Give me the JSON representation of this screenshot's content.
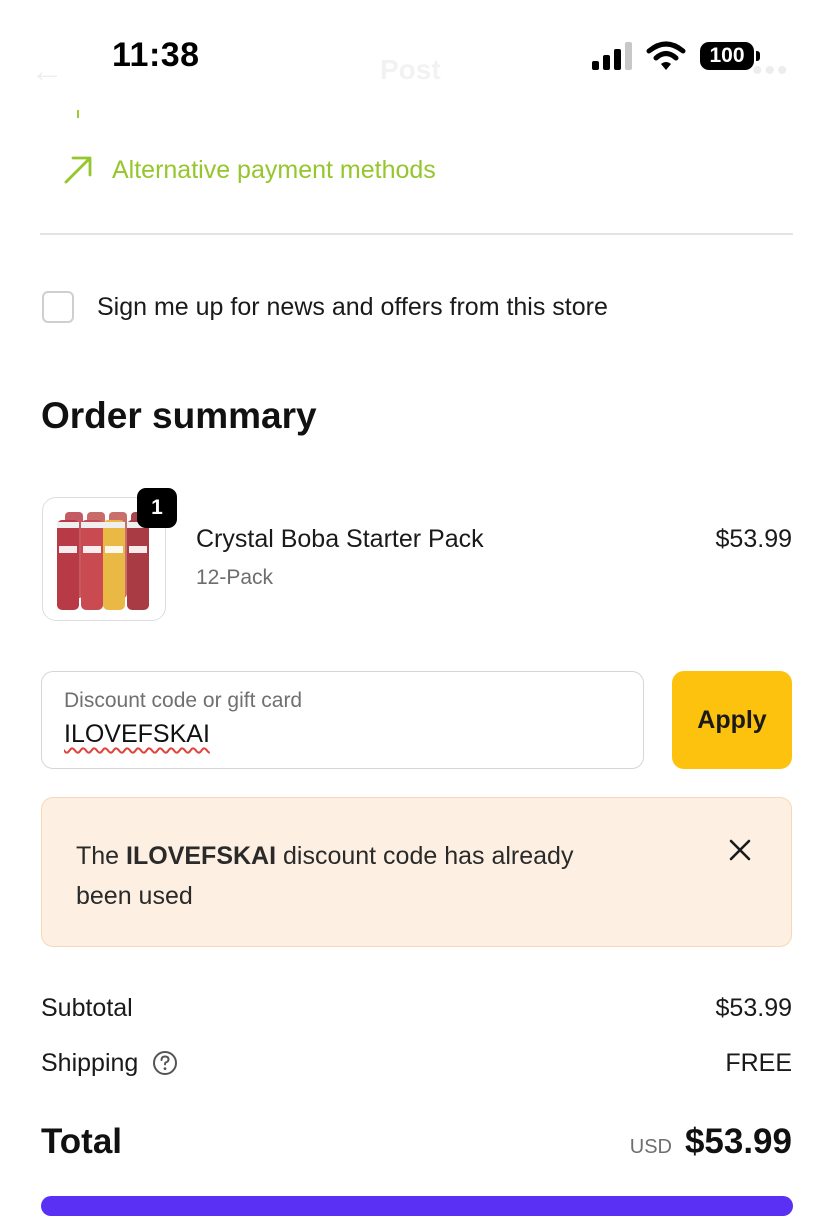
{
  "status_bar": {
    "time": "11:38",
    "battery": "100",
    "icons": [
      "signal-icon",
      "wifi-icon",
      "battery-icon"
    ]
  },
  "background_header": {
    "title": "Post",
    "back_icon": "back-arrow-icon",
    "more_icon": "more-icon"
  },
  "payment": {
    "alternative_link_label": "Alternative payment methods",
    "alternative_icon": "arrow-up-right-icon",
    "accent_color": "#95c62c"
  },
  "newsletter": {
    "label": "Sign me up for news and offers from this store",
    "checked": false
  },
  "order_summary": {
    "title": "Order summary",
    "items": [
      {
        "name": "Crystal Boba Starter Pack",
        "variant": "12-Pack",
        "quantity": "1",
        "price": "$53.99",
        "image_icon": "product-bottles-image"
      }
    ]
  },
  "discount": {
    "placeholder": "Discount code or gift card",
    "value": "ILOVEFSKAI",
    "apply_label": "Apply",
    "apply_color": "#fcc20d",
    "error": {
      "prefix": "The ",
      "code": "ILOVEFSKAI",
      "suffix": " discount code has already been used",
      "close_icon": "close-icon"
    }
  },
  "totals": {
    "subtotal_label": "Subtotal",
    "subtotal_value": "$53.99",
    "shipping_label": "Shipping",
    "shipping_value": "FREE",
    "shipping_help_icon": "help-circle-icon",
    "total_label": "Total",
    "currency": "USD",
    "total_value": "$53.99"
  }
}
